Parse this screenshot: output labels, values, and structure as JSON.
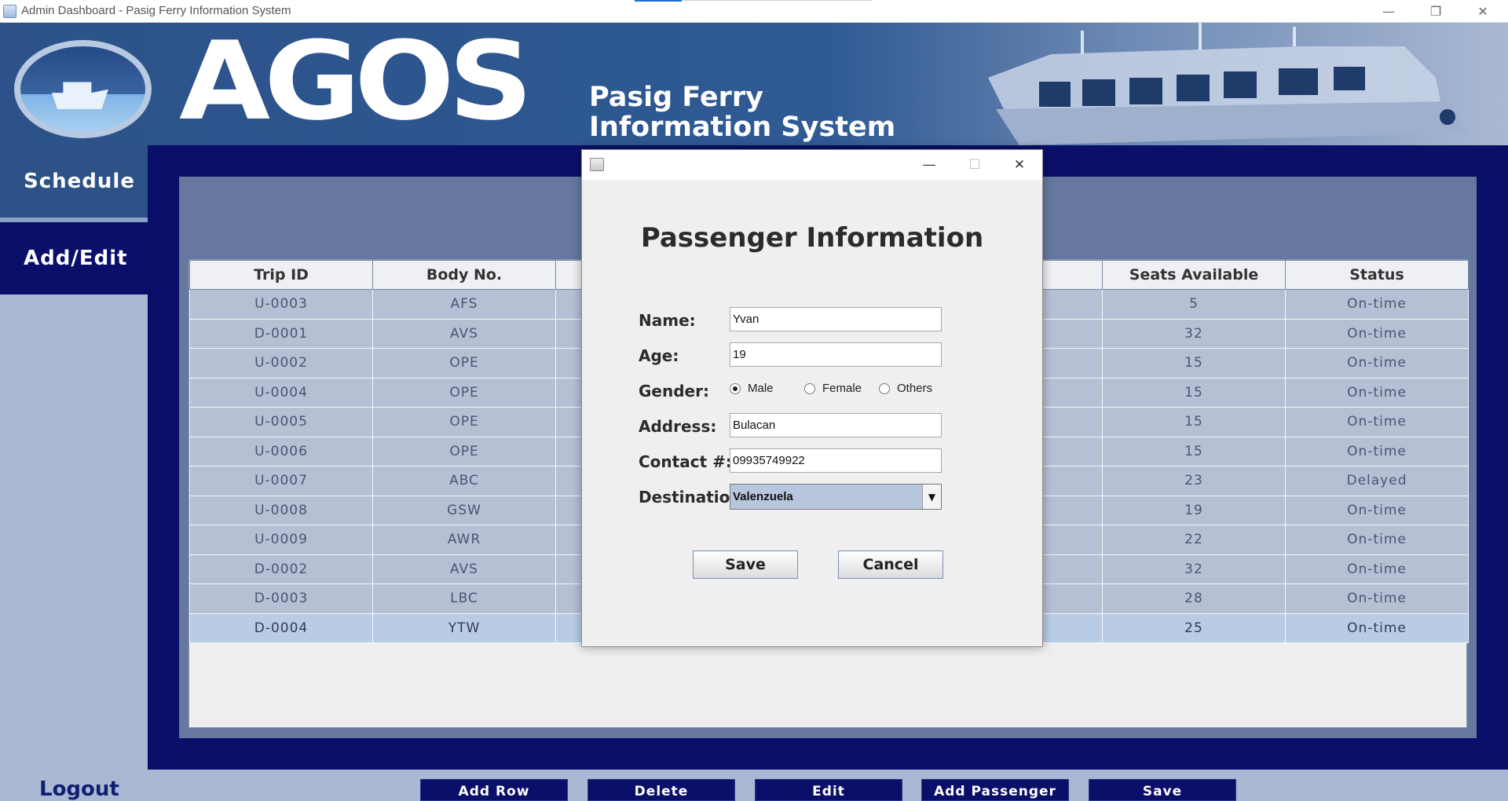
{
  "window": {
    "title": "Admin Dashboard - Pasig Ferry Information System",
    "minimize": "—",
    "restore": "❐",
    "close": "✕"
  },
  "header": {
    "brand": "AGOS",
    "subtitle_line1": "Pasig Ferry",
    "subtitle_line2": "Information System"
  },
  "sidebar": {
    "items": [
      {
        "label": "Schedule"
      },
      {
        "label": "Add/Edit"
      }
    ],
    "logout": "Logout"
  },
  "table": {
    "columns": [
      "Trip ID",
      "Body No.",
      "Seats Available",
      "Status"
    ],
    "rows": [
      [
        "U-0003",
        "AFS",
        "5",
        "On-time"
      ],
      [
        "D-0001",
        "AVS",
        "32",
        "On-time"
      ],
      [
        "U-0002",
        "OPE",
        "15",
        "On-time"
      ],
      [
        "U-0004",
        "OPE",
        "15",
        "On-time"
      ],
      [
        "U-0005",
        "OPE",
        "15",
        "On-time"
      ],
      [
        "U-0006",
        "OPE",
        "15",
        "On-time"
      ],
      [
        "U-0007",
        "ABC",
        "23",
        "Delayed"
      ],
      [
        "U-0008",
        "GSW",
        "19",
        "On-time"
      ],
      [
        "U-0009",
        "AWR",
        "22",
        "On-time"
      ],
      [
        "D-0002",
        "AVS",
        "32",
        "On-time"
      ],
      [
        "D-0003",
        "LBC",
        "28",
        "On-time"
      ],
      [
        "D-0004",
        "YTW",
        "25",
        "On-time"
      ]
    ],
    "selected_row": 11
  },
  "toolbar": {
    "buttons": [
      "Add Row",
      "Delete",
      "Edit",
      "Add Passenger",
      "Save"
    ]
  },
  "dialog": {
    "minimize": "—",
    "maximize": "☐",
    "close": "✕",
    "heading": "Passenger Information",
    "name_label": "Name:",
    "name_value": "Yvan",
    "age_label": "Age:",
    "age_value": "19",
    "gender_label": "Gender:",
    "gender_options": [
      "Male",
      "Female",
      "Others"
    ],
    "gender_selected": "Male",
    "address_label": "Address:",
    "address_value": "Bulacan",
    "contact_label": "Contact #:",
    "contact_value": "09935749922",
    "destination_label": "Destination:",
    "destination_value": "Valenzuela",
    "save_label": "Save",
    "cancel_label": "Cancel"
  },
  "colors": {
    "nav_dark": "#0a0f6a",
    "nav_schedule": "#2d5288",
    "header_blue": "#2c5289",
    "table_row": "#b6c0d4",
    "selected_row": "#b9cce6"
  }
}
